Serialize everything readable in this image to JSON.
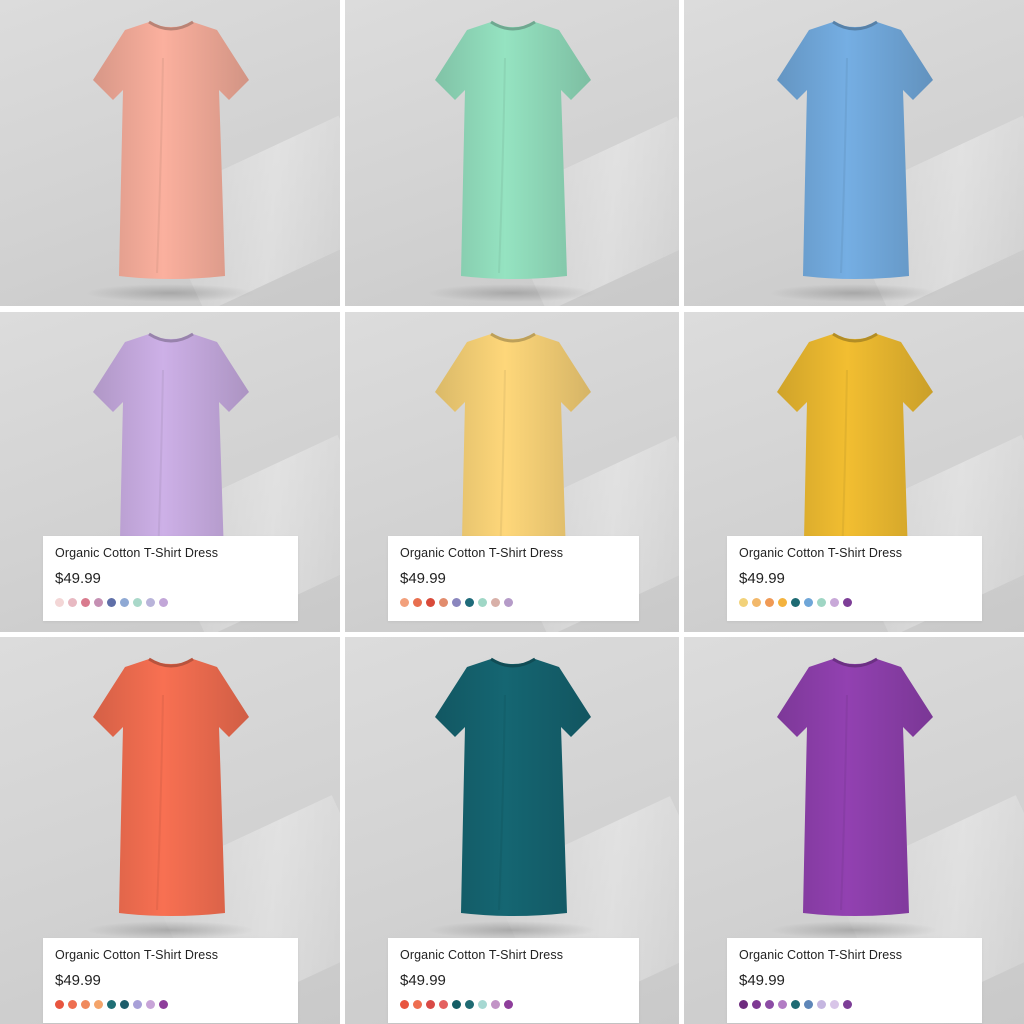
{
  "products": [
    {
      "color": "#EFA896",
      "title": "",
      "price": "",
      "swatches": []
    },
    {
      "color": "#8ED8B8",
      "title": "",
      "price": "",
      "swatches": []
    },
    {
      "color": "#6FA6D8",
      "title": "",
      "price": "",
      "swatches": []
    },
    {
      "color": "#C3A8DC",
      "title": "Organic Cotton T-Shirt Dress",
      "price": "$49.99",
      "swatches": [
        "#F3D6D6",
        "#E8B9C2",
        "#D97B8E",
        "#C590B3",
        "#5F6FA8",
        "#8FA9D4",
        "#A9D8C9",
        "#B9B4DA",
        "#C2A6D8"
      ]
    },
    {
      "color": "#F2CD74",
      "title": "Organic Cotton T-Shirt Dress",
      "price": "$49.99",
      "swatches": [
        "#F2A07C",
        "#E86F4F",
        "#D94A3A",
        "#E28C6D",
        "#8A86BE",
        "#1F6B7A",
        "#9FD7C6",
        "#D8B0A8",
        "#B59BC8"
      ]
    },
    {
      "color": "#E6B52F",
      "title": "Organic Cotton T-Shirt Dress",
      "price": "$49.99",
      "swatches": [
        "#F2D27A",
        "#F2B86A",
        "#F09A55",
        "#F4B33E",
        "#1E6B73",
        "#6FA6D8",
        "#9FD6C4",
        "#C8A8D8",
        "#7D3E97"
      ]
    },
    {
      "color": "#EC6B4E",
      "title": "Organic Cotton T-Shirt Dress",
      "price": "$49.99",
      "swatches": [
        "#E8553F",
        "#EE6E50",
        "#F08A5D",
        "#F4A46A",
        "#1F6F75",
        "#1E5E6B",
        "#A8A0D8",
        "#C8A4D8",
        "#8E3E9B"
      ]
    },
    {
      "color": "#14616D",
      "title": "Organic Cotton T-Shirt Dress",
      "price": "$49.99",
      "swatches": [
        "#E8553F",
        "#EE6E50",
        "#D94A46",
        "#E4605F",
        "#155E66",
        "#1F6B73",
        "#A6D8D2",
        "#C293C6",
        "#8E3E9B"
      ]
    },
    {
      "color": "#8B3EA9",
      "title": "Organic Cotton T-Shirt Dress",
      "price": "$49.99",
      "swatches": [
        "#6E2C7E",
        "#7E3A93",
        "#8C4CA5",
        "#B27CC4",
        "#1F6B73",
        "#5E86B8",
        "#C5B6E0",
        "#D8C5E8",
        "#7D3E97"
      ]
    }
  ]
}
